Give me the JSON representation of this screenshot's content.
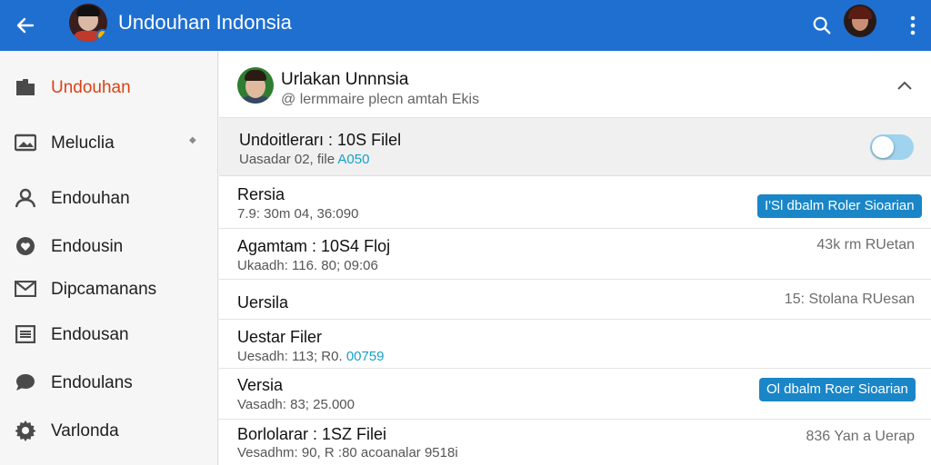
{
  "appbar": {
    "title": "Undouhan Indonsia",
    "back_icon": "arrow-left-icon",
    "search_icon": "search-icon",
    "more_icon": "more-vertical-icon",
    "brand_color": "#1f6fd1"
  },
  "sidebar": {
    "items": [
      {
        "label": "Undouhan",
        "icon": "folder-icon",
        "active": true
      },
      {
        "label": "Meluclia",
        "icon": "image-icon",
        "expandable": true
      },
      {
        "label": "Endouhan",
        "icon": "person-icon"
      },
      {
        "label": "Endousin",
        "icon": "heart-icon"
      },
      {
        "label": "Dipcamanans",
        "icon": "mail-icon"
      },
      {
        "label": "Endousan",
        "icon": "list-icon"
      },
      {
        "label": "Endoulans",
        "icon": "chat-icon"
      },
      {
        "label": "Varlonda",
        "icon": "gear-icon"
      }
    ],
    "active_color": "#d84315"
  },
  "header_card": {
    "name": "Urlakan Unnnsia",
    "subtitle": "@ lermmaire plecn amtah Ekis",
    "collapse_icon": "chevron-up-icon"
  },
  "toggle_row": {
    "title": "Undoitlerarı : 10S Filel",
    "subtitle_prefix": "Uasadar 02, file",
    "subtitle_accent": "A050",
    "switch_on": true
  },
  "rows": [
    {
      "title": "Rersia",
      "subtitle": "7.9: 30m 04, 36:090",
      "action": "I'Sl dbalm Roler Sioarian"
    },
    {
      "title": "Agamtam : 10S4 Floj",
      "subtitle": "Ukaadh: 116. 80; 09:06",
      "meta": "43k rm RUetan"
    },
    {
      "title": "Uersila",
      "meta": "15: Stolana RUesan"
    },
    {
      "title": "Uestar Filer",
      "subtitle_prefix": "Uesadh: 113; R0.",
      "subtitle_accent": "00759"
    },
    {
      "title": "Versia",
      "subtitle": "Vasadh: 83; 25.000",
      "action": "Ol dbalm Roer Sioarian"
    },
    {
      "title": "Borlolarar : 1SZ Filei",
      "subtitle": "Vesadhm: 90, R :80 acoanalar 9518i",
      "meta": "836 Yan a Uerap"
    }
  ],
  "colors": {
    "accent_text": "#18a0c8",
    "action_button": "#1a86c7"
  }
}
